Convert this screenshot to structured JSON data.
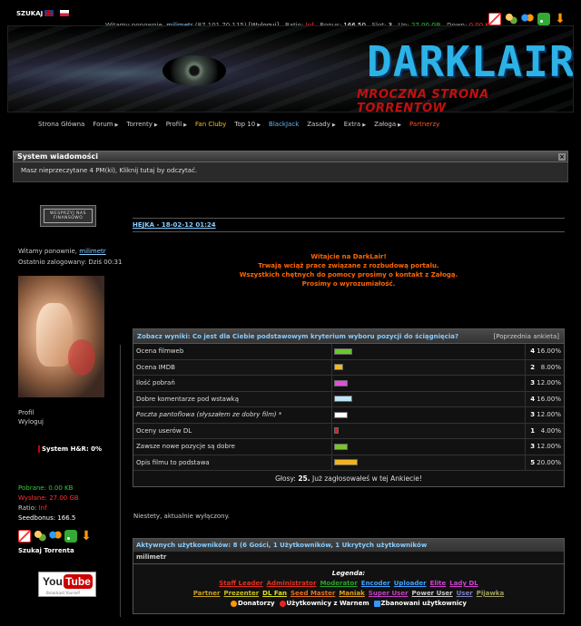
{
  "top": {
    "search_label": "SZUKAJ",
    "userline": {
      "prefix": "Witamy ponownie,",
      "username": "milimetr",
      "ip": "(87.101.70.115)",
      "logout": "[Wyloguj]",
      "ratio_label": "Ratio:",
      "ratio_value": "Inf",
      "bonus_label": "Bonus:",
      "bonus_value": "166.50",
      "slot_label": "Slot:",
      "slot_value": "3",
      "up_label": "Up:",
      "up_value": "27.00 GB",
      "down_label": "Down:",
      "down_value": "0.00 KB"
    }
  },
  "banner": {
    "logo": "DARKLAIR",
    "tagline": "MROCZNA STRONA TORRENTÓW"
  },
  "nav": [
    {
      "label": "Strona Główna",
      "caret": false,
      "color": "#cccccc"
    },
    {
      "label": "Forum",
      "caret": true,
      "color": "#cccccc"
    },
    {
      "label": "Torrenty",
      "caret": true,
      "color": "#cccccc"
    },
    {
      "label": "Profil",
      "caret": true,
      "color": "#cccccc"
    },
    {
      "label": "Fan Cluby",
      "caret": false,
      "color": "#f0c020"
    },
    {
      "label": "Top 10",
      "caret": true,
      "color": "#cccccc"
    },
    {
      "label": "BlackJack",
      "caret": false,
      "color": "#66b8f0"
    },
    {
      "label": "Zasady",
      "caret": true,
      "color": "#cccccc"
    },
    {
      "label": "Extra",
      "caret": true,
      "color": "#cccccc"
    },
    {
      "label": "Załoga",
      "caret": true,
      "color": "#cccccc"
    },
    {
      "label": "Partnerzy",
      "caret": false,
      "color": "#ff5522"
    }
  ],
  "system": {
    "title": "System wiadomości",
    "message": "Masz nieprzeczytane 4 PM(ki), Kliknij tutaj by odczytać."
  },
  "sidebar": {
    "donate": "WESPRZYJ NAS FINANSOWO",
    "welcome_prefix": "Witamy ponownie,",
    "username": "milimetr",
    "last_login": "Ostatnio zalogowany: Dziś 00:31",
    "profile_link": "Profil",
    "logout_link": "Wyloguj",
    "hr_label": "System H&R: 0%",
    "downloaded": "Pobrane: 0.00 KB",
    "uploaded": "Wysłane: 27.00 GB",
    "ratio_label": "Ratio:",
    "ratio_value": "Inf",
    "seedbonus": "Seedbonus: 166.5",
    "search_torrent": "Szukaj Torrenta",
    "youtube_you": "You",
    "youtube_tube": "Tube",
    "youtube_sub": "Broadcast Yourself"
  },
  "news": {
    "title": "HEJKA - 18-02-12 01:24",
    "lines": [
      "Witajcie na DarkLair!",
      "Trwają wciąż prace związane z rozbudową portalu.",
      "Wszystkich chętnych do pomocy prosimy o kontakt z Załogą.",
      "Prosimy o wyrozumiałość."
    ]
  },
  "poll": {
    "question": "Zobacz wyniki: Co jest dla Ciebie podstawowym kryterium wyboru pozycji do ściągnięcia?",
    "prev_label": "Poprzednia ankieta",
    "options": [
      {
        "label": "Ocena filmweb",
        "count": "4",
        "percent": "16.00%",
        "color": "#6bc72e",
        "italic": false
      },
      {
        "label": "Ocena IMDB",
        "count": "2",
        "percent": "8.00%",
        "color": "#f2b824",
        "italic": false
      },
      {
        "label": "Ilość pobrań",
        "count": "3",
        "percent": "12.00%",
        "color": "#e050d8",
        "italic": false
      },
      {
        "label": "Dobre komentarze pod wstawką",
        "count": "4",
        "percent": "16.00%",
        "color": "#bfe6f5",
        "italic": false
      },
      {
        "label": "Poczta pantoflowa (słyszałem ze dobry film) *",
        "count": "3",
        "percent": "12.00%",
        "color": "#ffffff",
        "italic": true
      },
      {
        "label": "Oceny userów DL",
        "count": "1",
        "percent": "4.00%",
        "color": "#e02020",
        "italic": false
      },
      {
        "label": "Zawsze nowe pozycje są dobre",
        "count": "3",
        "percent": "12.00%",
        "color": "#7cc22c",
        "italic": false
      },
      {
        "label": "Opis filmu to podstawa",
        "count": "5",
        "percent": "20.00%",
        "color": "#f3b51e",
        "italic": false
      }
    ],
    "votes_label": "Głosy:",
    "votes_value": "25.",
    "votes_suffix": "Już zagłosowałeś w tej Ankiecie!"
  },
  "disabled_msg": "Niestety, aktualnie wyłączony.",
  "online": {
    "title": "Aktywnych użytkowników: 8 (6 Gości, 1 Użytkowników, 1 Ukrytych użytkowników",
    "users": [
      "milimetr"
    ],
    "legend_title": "Legenda:",
    "legend_row1": [
      {
        "label": "Staff Leader",
        "color": "#e03020"
      },
      {
        "label": "Administrator",
        "color": "#e03020"
      },
      {
        "label": "Moderator",
        "color": "#2aa02a"
      },
      {
        "label": "Encoder",
        "color": "#40a0ff"
      },
      {
        "label": "Uploader",
        "color": "#40a0ff"
      },
      {
        "label": "Elite",
        "color": "#d040d0"
      },
      {
        "label": "Lady DL",
        "color": "#d040d0"
      }
    ],
    "legend_row2": [
      {
        "label": "Partner",
        "color": "#c8a020"
      },
      {
        "label": "Prezenter",
        "color": "#c8c020"
      },
      {
        "label": "DL Fan",
        "color": "#e0e020"
      },
      {
        "label": "Seed Master",
        "color": "#e07020"
      },
      {
        "label": "Maniak",
        "color": "#e0a020"
      },
      {
        "label": "Super User",
        "color": "#c040c0"
      },
      {
        "label": "Power User",
        "color": "#cccccc"
      },
      {
        "label": "User",
        "color": "#8080c0"
      },
      {
        "label": "Pijawka",
        "color": "#a0a060"
      }
    ],
    "legend_bottom": [
      "Donatorzy",
      "Użytkownicy z Warnem",
      "Zbanowani użytkownicy"
    ]
  }
}
